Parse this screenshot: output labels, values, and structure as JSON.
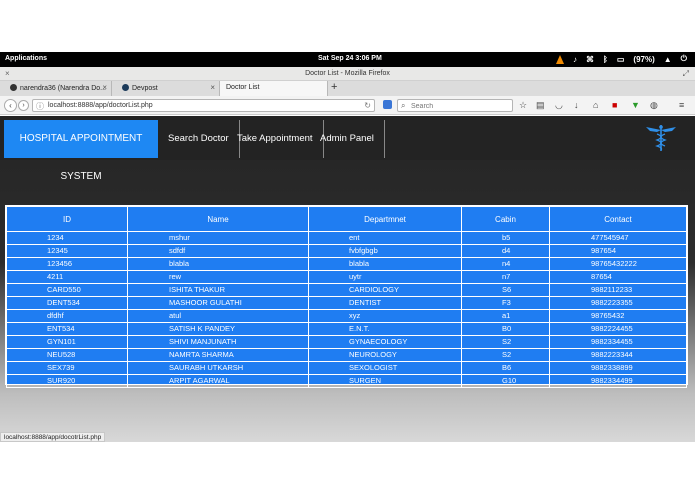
{
  "system_panel": {
    "applications": "Applications",
    "clock": "Sat Sep 24   3:06 PM",
    "battery": "(97%)"
  },
  "window": {
    "title": "Doctor List - Mozilla Firefox"
  },
  "tabs": [
    {
      "label": "narendra36 (Narendra Do..."
    },
    {
      "label": "Devpost"
    },
    {
      "label": "Doctor List"
    }
  ],
  "nav": {
    "url": "localhost:8888/app/doctorList.php",
    "search_placeholder": "Search"
  },
  "site": {
    "brand": "HOSPITAL APPOINTMENT SYSTEM",
    "menu": [
      "Search Doctor",
      "Take Appointment",
      "Admin Panel"
    ]
  },
  "table": {
    "headers": [
      "ID",
      "Name",
      "Departmnet",
      "Cabin",
      "Contact"
    ],
    "rows": [
      [
        "1234",
        "mshur",
        "ent",
        "b5",
        "477545947"
      ],
      [
        "12345",
        "sdfdf",
        "fvbfgbgb",
        "d4",
        "987654"
      ],
      [
        "123456",
        "blabla",
        "blabla",
        "n4",
        "98765432222"
      ],
      [
        "4211",
        "rew",
        "uytr",
        "n7",
        "87654"
      ],
      [
        "CARD550",
        "ISHITA THAKUR",
        "CARDIOLOGY",
        "S6",
        "9882112233"
      ],
      [
        "DENT534",
        "MASHOOR GULATHI",
        "DENTIST",
        "F3",
        "9882223355"
      ],
      [
        "dfdhf",
        "atul",
        "xyz",
        "a1",
        "98765432"
      ],
      [
        "ENT534",
        "SATISH K PANDEY",
        "E.N.T.",
        "B0",
        "9882224455"
      ],
      [
        "GYN101",
        "SHIVI MANJUNATH",
        "GYNAECOLOGY",
        "S2",
        "9882334455"
      ],
      [
        "NEU528",
        "NAMRTA SHARMA",
        "NEUROLOGY",
        "S2",
        "9882223344"
      ],
      [
        "SEX739",
        "SAURABH UTKARSH",
        "SEXOLOGIST",
        "B6",
        "9882338899"
      ],
      [
        "SUR920",
        "ARPIT AGARWAL",
        "SURGEN",
        "G10",
        "9882334499"
      ]
    ]
  },
  "status_link": "localhost:8888/app/docotrList.php",
  "colors": {
    "accent": "#1f7df2",
    "header": "#232323"
  }
}
